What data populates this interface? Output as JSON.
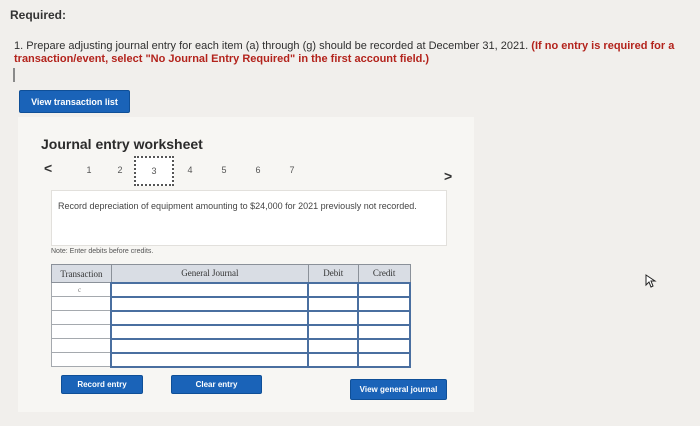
{
  "header": {
    "required_label": "Required:"
  },
  "instructions": {
    "main_text": "1. Prepare adjusting journal entry for each item (a) through (g) should be recorded at December 31, 2021.",
    "red_text": "(If no entry is required for a transaction/event, select \"No Journal Entry Required\" in the first account field.)"
  },
  "buttons": {
    "view_transaction_list": "View transaction list",
    "record_entry": "Record entry",
    "clear_entry": "Clear entry",
    "view_general_journal": "View general journal"
  },
  "worksheet": {
    "title": "Journal entry worksheet",
    "pages": [
      "1",
      "2",
      "3",
      "4",
      "5",
      "6",
      "7"
    ],
    "active_page": "3",
    "description": "Record depreciation of equipment amounting to $24,000 for 2021 previously not recorded.",
    "note": "Note: Enter debits before credits."
  },
  "table": {
    "headers": {
      "transaction": "Transaction",
      "general_journal": "General Journal",
      "debit": "Debit",
      "credit": "Credit"
    },
    "first_row_transaction": "c"
  },
  "icons": {
    "prev": "chevron-left-icon",
    "next": "chevron-right-icon",
    "cursor": "mouse-pointer-icon"
  },
  "colors": {
    "button_blue": "#1a63b8",
    "instruction_red": "#b3231c",
    "table_header": "#d9dde4"
  }
}
